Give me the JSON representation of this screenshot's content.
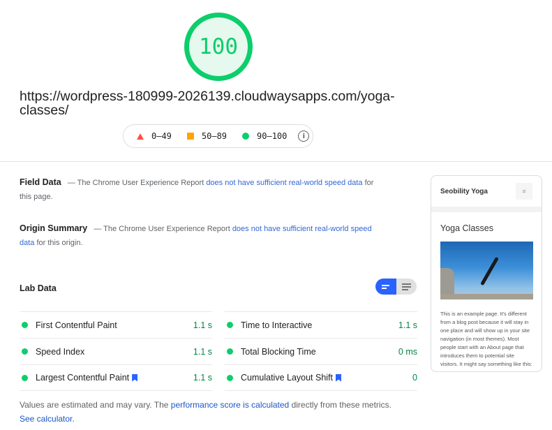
{
  "score": {
    "value": "100",
    "color": "#0cce6b"
  },
  "url": "https://wordpress-180999-2026139.cloudwaysapps.com/yoga-classes/",
  "legend": {
    "items": [
      {
        "shape": "triangle-icon",
        "range": "0–49",
        "color": "#ff4e42"
      },
      {
        "shape": "square-icon",
        "range": "50–89",
        "color": "#ffa400"
      },
      {
        "shape": "circle-icon",
        "range": "90–100",
        "color": "#0cce6b"
      }
    ],
    "info_icon": "i"
  },
  "field_data": {
    "title": "Field Data",
    "prefix": "— The Chrome User Experience Report",
    "link": "does not have sufficient real-world speed data",
    "suffix": "for this page."
  },
  "origin_summary": {
    "title": "Origin Summary",
    "prefix": "— The Chrome User Experience Report",
    "link": "does not have sufficient real-world speed data",
    "suffix": "for this origin."
  },
  "lab_data": {
    "title": "Lab Data",
    "view_toggle": {
      "active": "summary-view",
      "inactive": "detailed-view"
    },
    "metrics_left": [
      {
        "label": "First Contentful Paint",
        "value": "1.1 s",
        "bookmark": false
      },
      {
        "label": "Speed Index",
        "value": "1.1 s",
        "bookmark": false
      },
      {
        "label": "Largest Contentful Paint",
        "value": "1.1 s",
        "bookmark": true
      }
    ],
    "metrics_right": [
      {
        "label": "Time to Interactive",
        "value": "1.1 s",
        "bookmark": false
      },
      {
        "label": "Total Blocking Time",
        "value": "0 ms",
        "bookmark": false
      },
      {
        "label": "Cumulative Layout Shift",
        "value": "0",
        "bookmark": true
      }
    ]
  },
  "footnote": {
    "prefix": "Values are estimated and may vary. The",
    "link1": "performance score is calculated",
    "middle": "directly from these metrics.",
    "link2": "See calculator."
  },
  "preview": {
    "site_name": "Seobility Yoga",
    "menu_icon": "≡",
    "page_title": "Yoga Classes",
    "body": "This is an example page. It's different from a blog post because it will stay in one place and will show up in your site navigation (in most themes). Most people start with an About page that introduces them to potential site visitors. It might say something like this:"
  }
}
